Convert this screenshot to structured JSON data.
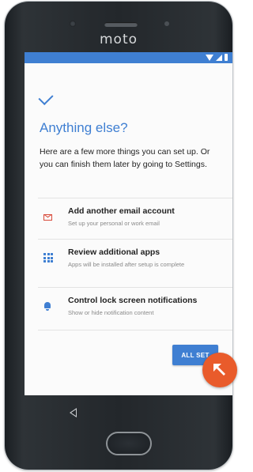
{
  "device": {
    "brand": "moto"
  },
  "screen": {
    "title": "Anything else?",
    "intro": "Here are a few more things you can set up. Or you can finish them later by going to Settings.",
    "options": [
      {
        "icon": "gmail-icon",
        "title": "Add another email account",
        "subtitle": "Set up your personal or work email"
      },
      {
        "icon": "apps-grid-icon",
        "title": "Review additional apps",
        "subtitle": "Apps will be installed after setup is complete"
      },
      {
        "icon": "bell-icon",
        "title": "Control lock screen notifications",
        "subtitle": "Show or hide notification content"
      }
    ],
    "done_button": "ALL SET"
  },
  "colors": {
    "accent": "#3f7fd2",
    "badge": "#e95b2b",
    "gmail": "#d84a3a"
  }
}
